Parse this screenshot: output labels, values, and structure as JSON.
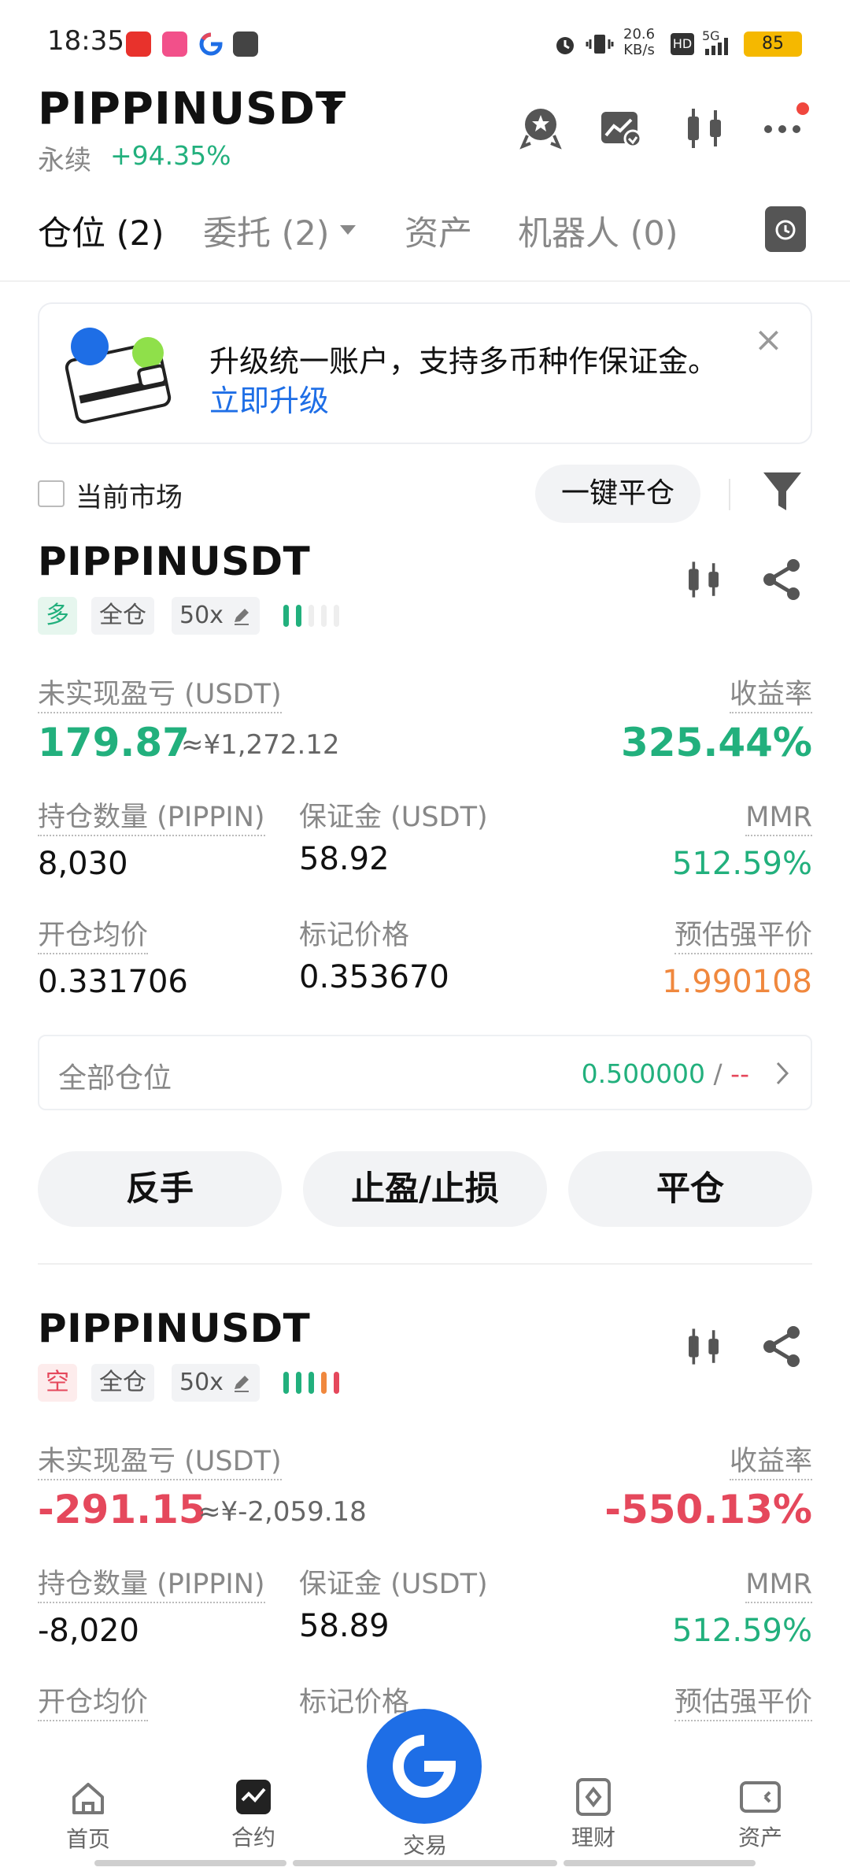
{
  "status_bar": {
    "time": "18:35",
    "net_speed_value": "20.6",
    "net_speed_unit": "KB/s",
    "hd": "HD",
    "signal": "5G",
    "battery": "85"
  },
  "header": {
    "pair": "PIPPINUSDT",
    "contract_type": "永续",
    "change": "+94.35%"
  },
  "tabs": [
    {
      "label": "仓位 (2)"
    },
    {
      "label": "委托 (2)"
    },
    {
      "label": "资产"
    },
    {
      "label": "机器人 (0)"
    }
  ],
  "banner": {
    "text": "升级统一账户，支持多币种作保证金。",
    "link": "立即升级",
    "close": "×"
  },
  "filter": {
    "current_market": "当前市场",
    "close_all": "一键平仓"
  },
  "positions": [
    {
      "pair": "PIPPINUSDT",
      "side": "多",
      "margin_mode": "全仓",
      "leverage": "50x",
      "pnl_label": "未实现盈亏 (USDT)",
      "pnl": "179.87",
      "pnl_cny": "≈¥1,272.12",
      "roe_label": "收益率",
      "roe": "325.44%",
      "size_label": "持仓数量 (PIPPIN)",
      "size": "8,030",
      "margin_label": "保证金 (USDT)",
      "margin": "58.92",
      "mmr_label": "MMR",
      "mmr": "512.59%",
      "entry_label": "开仓均价",
      "entry": "0.331706",
      "mark_label": "标记价格",
      "mark": "0.353670",
      "liq_label": "预估强平价",
      "liq": "1.990108",
      "all_pos_label": "全部仓位",
      "all_pos_tp": "0.500000",
      "all_pos_sl": "--",
      "btn_reverse": "反手",
      "btn_tpsl": "止盈/止损",
      "btn_close": "平仓"
    },
    {
      "pair": "PIPPINUSDT",
      "side": "空",
      "margin_mode": "全仓",
      "leverage": "50x",
      "pnl_label": "未实现盈亏 (USDT)",
      "pnl": "-291.15",
      "pnl_cny": "≈¥-2,059.18",
      "roe_label": "收益率",
      "roe": "-550.13%",
      "size_label": "持仓数量 (PIPPIN)",
      "size": "-8,020",
      "margin_label": "保证金 (USDT)",
      "margin": "58.89",
      "mmr_label": "MMR",
      "mmr": "512.59%",
      "entry_label": "开仓均价",
      "mark_label": "标记价格",
      "liq_label": "预估强平价"
    }
  ],
  "bottom_nav": [
    {
      "label": "首页",
      "icon": "home-icon"
    },
    {
      "label": "合约",
      "icon": "contract-icon"
    },
    {
      "label": "交易",
      "icon": "trade-icon"
    },
    {
      "label": "理财",
      "icon": "finance-icon"
    },
    {
      "label": "资产",
      "icon": "wallet-icon"
    }
  ],
  "colors": {
    "up": "#22b07d",
    "down": "#e5485c",
    "warning": "#f0883e",
    "accent": "#1e6ee6"
  }
}
